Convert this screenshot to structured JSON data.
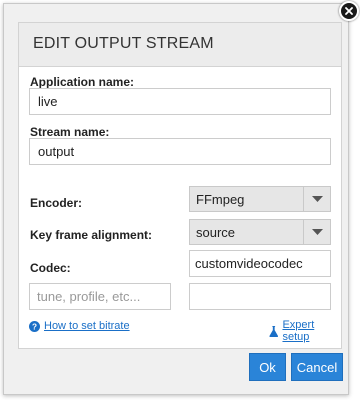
{
  "dialog": {
    "title": "EDIT OUTPUT STREAM",
    "close_icon": "close-icon"
  },
  "fields": {
    "application_name": {
      "label": "Application name:",
      "value": "live"
    },
    "stream_name": {
      "label": "Stream name:",
      "value": "output"
    },
    "encoder": {
      "label": "Encoder:",
      "value": "FFmpeg"
    },
    "key_frame_alignment": {
      "label": "Key frame alignment:",
      "value": "source"
    },
    "codec": {
      "label": "Codec:",
      "value": "customvideocodec"
    },
    "codec_params": {
      "placeholder": "tune, profile, etc...",
      "value": ""
    },
    "extra_param": {
      "value": ""
    }
  },
  "links": {
    "bitrate_help": "How to set bitrate",
    "expert_setup": "Expert setup"
  },
  "buttons": {
    "ok": "Ok",
    "cancel": "Cancel"
  },
  "colors": {
    "accent": "#2a84d8",
    "link": "#1a6fc7"
  }
}
